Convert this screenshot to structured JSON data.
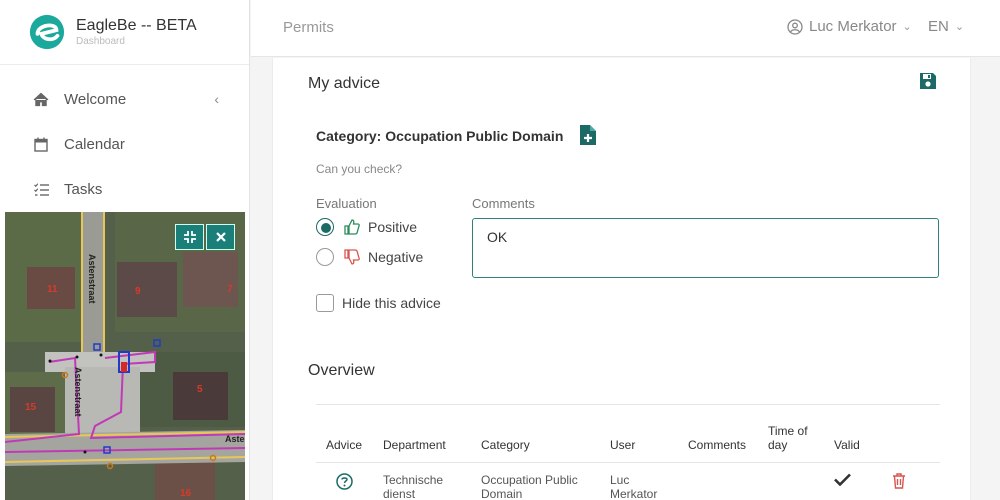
{
  "app": {
    "title": "EagleBe -- BETA",
    "subtitle": "Dashboard"
  },
  "sidebar": {
    "items": [
      {
        "label": "Welcome",
        "icon": "home-icon"
      },
      {
        "label": "Calendar",
        "icon": "calendar-icon"
      },
      {
        "label": "Tasks",
        "icon": "tasks-icon"
      }
    ]
  },
  "map": {
    "street_labels": [
      "Astenstraat",
      "Astenstraat",
      "Aste"
    ],
    "house_numbers": [
      "11",
      "9",
      "7",
      "5",
      "15",
      "16"
    ]
  },
  "header": {
    "breadcrumb": "Permits",
    "user": "Luc Merkator",
    "language": "EN"
  },
  "advice": {
    "title": "My advice",
    "category": "Category: Occupation Public Domain",
    "question": "Can you check?",
    "evaluation_label": "Evaluation",
    "positive_label": "Positive",
    "negative_label": "Negative",
    "comments_label": "Comments",
    "comments_value": "OK",
    "hide_label": "Hide this advice"
  },
  "overview": {
    "title": "Overview",
    "columns": [
      "Advice",
      "Department",
      "Category",
      "User",
      "Comments",
      "Time of day",
      "Valid"
    ],
    "rows": [
      {
        "department": "Technische dienst",
        "category": "Occupation Public Domain",
        "user": "Luc Merkator",
        "comments": "",
        "time": ""
      }
    ]
  },
  "colors": {
    "accent": "#1b6a66",
    "danger": "#d9534f",
    "map_button": "#1b7f79"
  }
}
